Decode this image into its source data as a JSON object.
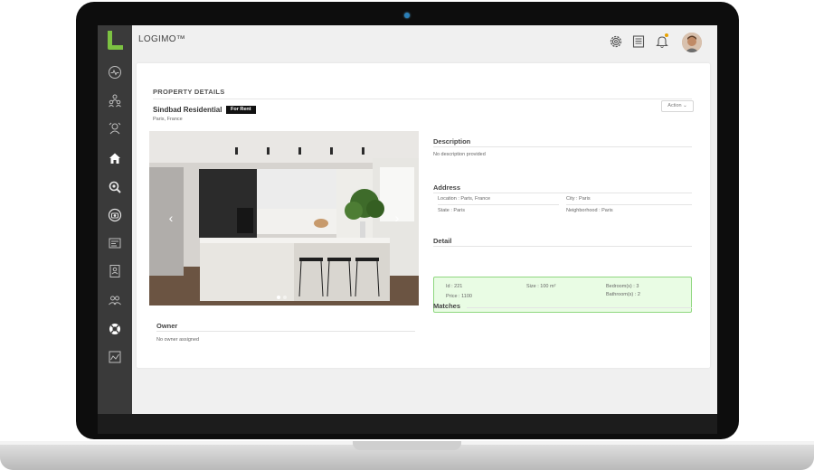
{
  "app": {
    "title": "LOGIMO™"
  },
  "colors": {
    "accent": "#7cc242",
    "sidebar": "#3a3a3a",
    "detail_bg": "#e9fce4",
    "detail_border": "#8fd77f",
    "notification": "#e8a200"
  },
  "sidebar": {
    "items": [
      {
        "icon": "activity-icon"
      },
      {
        "icon": "users-network-icon"
      },
      {
        "icon": "contacts-icon"
      },
      {
        "icon": "home-icon",
        "active": true
      },
      {
        "icon": "search-icon"
      },
      {
        "icon": "camera-icon"
      },
      {
        "icon": "listing-icon"
      },
      {
        "icon": "id-card-icon"
      },
      {
        "icon": "group-icon"
      },
      {
        "icon": "support-icon"
      },
      {
        "icon": "chart-icon"
      }
    ]
  },
  "header": {
    "icons": [
      "gear-icon",
      "document-icon",
      "bell-icon"
    ],
    "has_notification": true
  },
  "page": {
    "title": "PROPERTY DETAILS",
    "property_name": "Sindbad Residential",
    "badge": "For Rent",
    "location": "Paris, France",
    "action_button": "Action",
    "action_chevron": "⌄"
  },
  "gallery": {
    "prev": "‹",
    "next": "›",
    "slide_count": 2,
    "current_slide": 1
  },
  "owner": {
    "title": "Owner",
    "text": "No owner assigned"
  },
  "description": {
    "title": "Description",
    "text": "No description provided"
  },
  "address": {
    "title": "Address",
    "location": "Location : Paris, France",
    "city": "City : Paris",
    "state": "State : Paris",
    "neighborhood": "Neighborhood : Paris"
  },
  "detail": {
    "title": "Detail",
    "id": "Id : 221",
    "price": "Price : 1100",
    "size": "Size : 100 m²",
    "bedrooms": "Bedroom(s) : 3",
    "bathrooms": "Bathroom(s) : 2"
  },
  "matches": {
    "title": "Matches"
  }
}
